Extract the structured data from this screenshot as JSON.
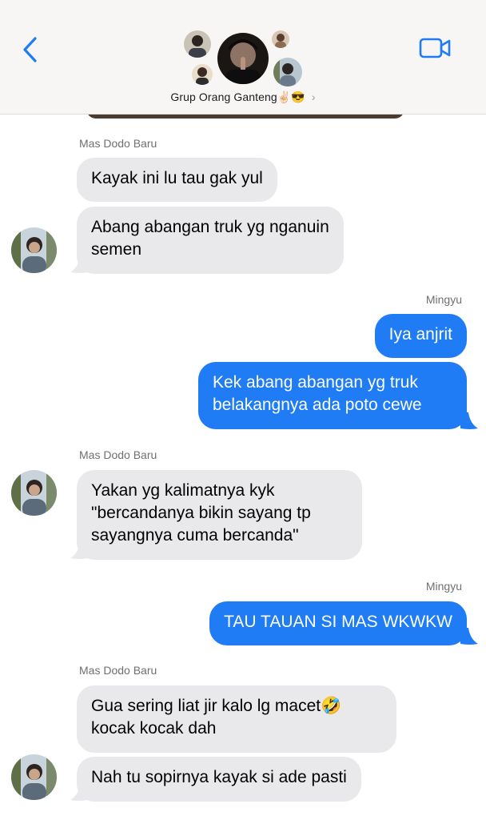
{
  "header": {
    "group_name": "Grup Orang Ganteng✌🏻😎",
    "chevron": "›",
    "back_icon": "chevron-left-icon",
    "video_icon": "video-camera-icon",
    "accent_color": "#1f7cf5"
  },
  "messages": [
    {
      "sender": "Mas Dodo Baru",
      "direction": "incoming",
      "lines": [
        "Kayak ini lu tau gak yul"
      ]
    },
    {
      "direction": "incoming",
      "lines": [
        "Abang abangan truk yg nganuin",
        "semen"
      ]
    },
    {
      "sender": "Mingyu",
      "direction": "outgoing",
      "lines": [
        "Iya anjrit"
      ]
    },
    {
      "direction": "outgoing",
      "lines": [
        "Kek abang abangan yg truk",
        "belakangnya ada poto cewe"
      ]
    },
    {
      "sender": "Mas Dodo Baru",
      "direction": "incoming",
      "lines": [
        "Yakan yg kalimatnya kyk",
        "\"bercandanya bikin sayang tp",
        "sayangnya cuma bercanda\""
      ]
    },
    {
      "sender": "Mingyu",
      "direction": "outgoing",
      "lines": [
        "TAU TAUAN SI MAS WKWKW"
      ]
    },
    {
      "sender": "Mas Dodo Baru",
      "direction": "incoming",
      "lines": [
        "Gua sering liat jir kalo lg macet🤣",
        "kocak kocak dah"
      ]
    },
    {
      "direction": "incoming",
      "lines": [
        "Nah tu sopirnya kayak si ade pasti"
      ]
    }
  ]
}
